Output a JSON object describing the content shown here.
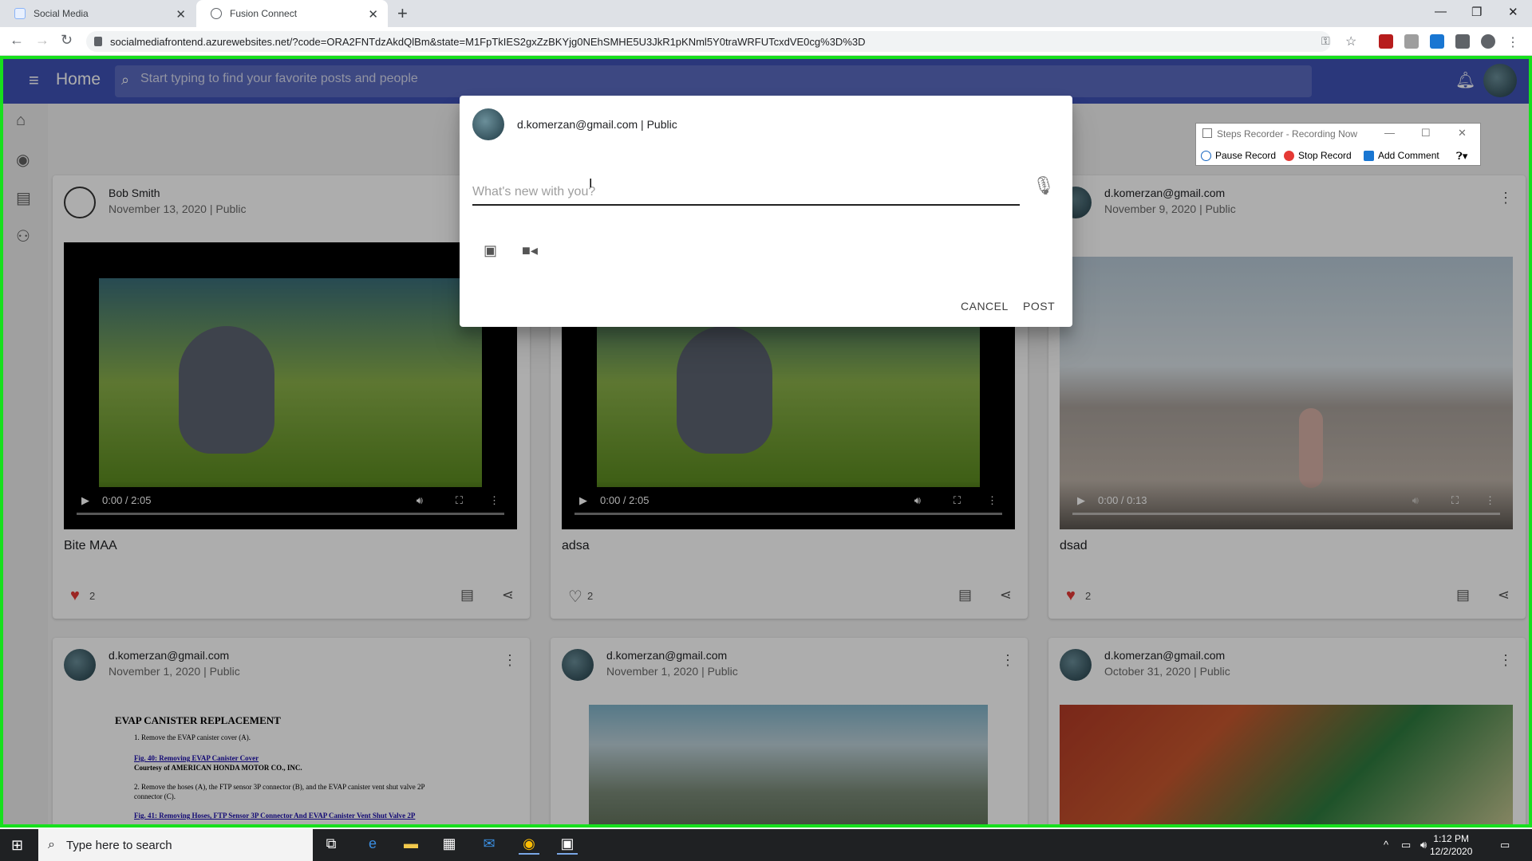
{
  "browser": {
    "tabs": [
      {
        "label": "Social Media"
      },
      {
        "label": "Fusion Connect"
      }
    ],
    "url": "socialmediafrontend.azurewebsites.net/?code=ORA2FNTdzAkdQlBm&state=M1FpTkIES2gxZzBKYjg0NEhSMHE5U3JkR1pKNml5Y0traWRFUTcxdVE0cg%3D%3D"
  },
  "app": {
    "title": "Home",
    "search_placeholder": "Start typing to find your favorite posts and people",
    "nav_icons": [
      "home-icon",
      "account-icon",
      "chat-icon",
      "group-icon"
    ]
  },
  "posts": [
    {
      "author": "Bob Smith",
      "meta": "November 13, 2020 | Public",
      "video_time": "0:00 / 2:05",
      "caption": "Bite MAA",
      "likes": "2",
      "liked": true
    },
    {
      "author": "",
      "meta": "",
      "video_time": "0:00 / 2:05",
      "caption": "adsa",
      "likes": "2",
      "liked": false
    },
    {
      "author": "d.komerzan@gmail.com",
      "meta": "November 9, 2020 | Public",
      "video_time": "0:00 / 0:13",
      "caption": "dsad",
      "likes": "2",
      "liked": true
    },
    {
      "author": "d.komerzan@gmail.com",
      "meta": "November 1, 2020 | Public",
      "doc_title": "EVAP CANISTER REPLACEMENT",
      "doc_lines": [
        "1.   Remove the EVAP canister cover (A).",
        "Fig. 40: Removing EVAP Canister Cover",
        "Courtesy of AMERICAN HONDA MOTOR CO., INC.",
        "2.   Remove the hoses (A), the FTP sensor 3P connector (B), and the EVAP canister vent shut valve 2P",
        "connector (C).",
        "Fig. 41: Removing Hoses, FTP Sensor 3P Connector And EVAP Canister Vent Shut Valve 2P"
      ]
    },
    {
      "author": "d.komerzan@gmail.com",
      "meta": "November 1, 2020 | Public"
    },
    {
      "author": "d.komerzan@gmail.com",
      "meta": "October 31, 2020 | Public"
    }
  ],
  "modal": {
    "user": "d.komerzan@gmail.com | Public",
    "placeholder": "What's new with you?",
    "cancel_label": "CANCEL",
    "post_label": "POST"
  },
  "steps_recorder": {
    "title": "Steps Recorder - Recording Now",
    "pause_label": "Pause Record",
    "stop_label": "Stop Record",
    "comment_label": "Add Comment"
  },
  "taskbar": {
    "search_placeholder": "Type here to search",
    "time": "1:12 PM",
    "date": "12/2/2020"
  },
  "colors": {
    "appbar": "#3f51b5",
    "recording_border": "#17e01d",
    "like_red": "#e53935"
  }
}
